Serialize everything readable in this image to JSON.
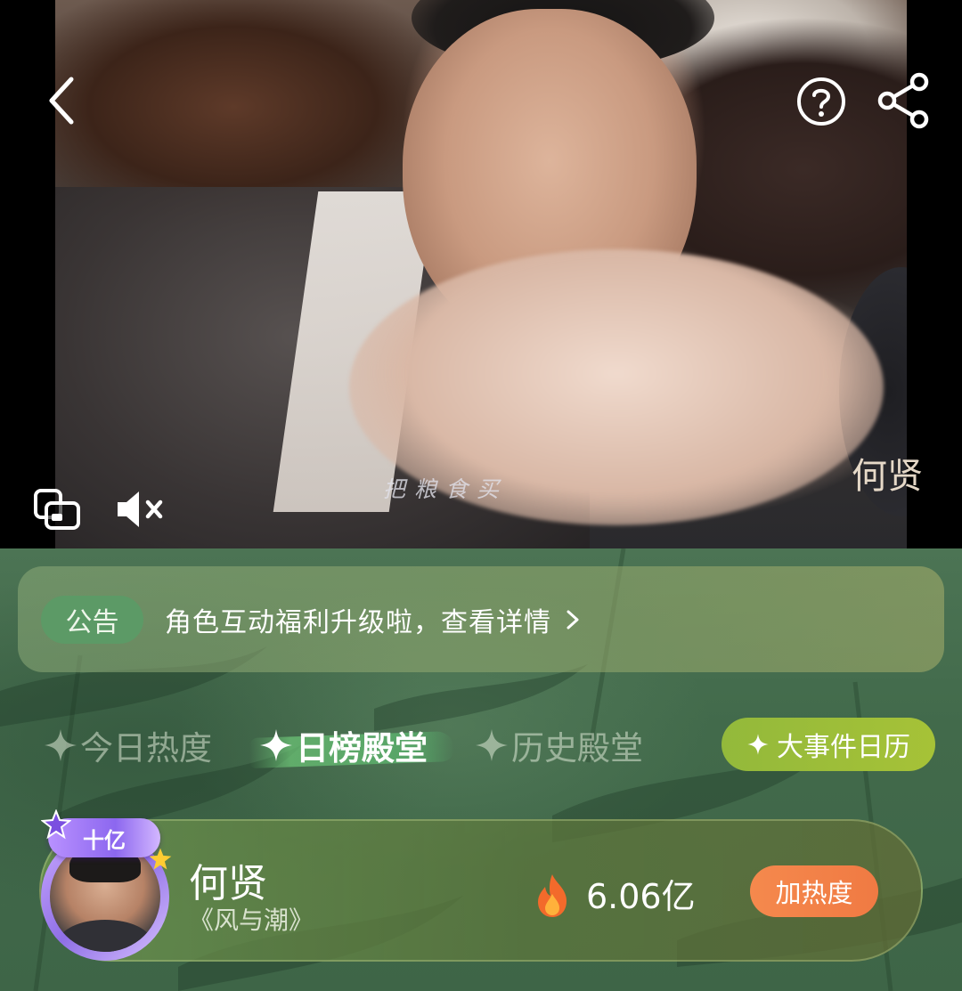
{
  "video": {
    "subtitle_text": "把粮食买",
    "watermark_text": "何贤",
    "icons": {
      "back": "chevron-left-icon",
      "help": "question-circle-icon",
      "share": "share-icon",
      "pip": "picture-in-picture-icon",
      "mute": "volume-mute-icon"
    }
  },
  "announcement": {
    "badge_label": "公告",
    "text": "角色互动福利升级啦，查看详情",
    "icon": "chevron-right-icon"
  },
  "tabs": [
    {
      "label": "今日热度",
      "active": false
    },
    {
      "label": "日榜殿堂",
      "active": true
    },
    {
      "label": "历史殿堂",
      "active": false
    }
  ],
  "event_calendar": {
    "label": "大事件日历",
    "icon": "sparkle-icon"
  },
  "ranking": [
    {
      "badge": "十亿",
      "name": "何贤",
      "drama": "《风与潮》",
      "heat": "6.06亿",
      "action_label": "加热度",
      "icon": "fire-icon"
    }
  ],
  "colors": {
    "green_background": "#426a4b",
    "announcement_badge": "#5c9a66",
    "calendar_button": "#9bbd39",
    "heat_button": "#f2804a",
    "avatar_ring": "#a98af0"
  }
}
